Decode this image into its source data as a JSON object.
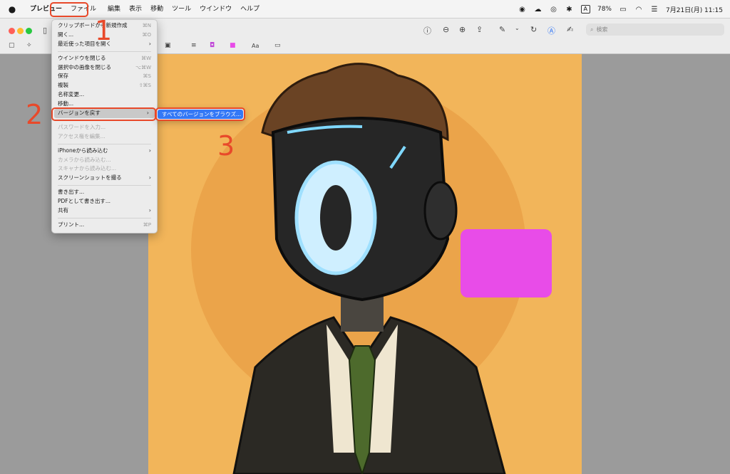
{
  "menubar": {
    "app": "プレビュー",
    "items": [
      "ファイル",
      "編集",
      "表示",
      "移動",
      "ツール",
      "ウインドウ",
      "ヘルプ"
    ],
    "battery": "78%",
    "input_badge": "A",
    "clock": "7月21日(月)  11:15"
  },
  "toolbar": {
    "search_placeholder": "検索",
    "text_style": "Aa"
  },
  "file_menu": {
    "items": [
      {
        "label": "クリップボードから新規作成",
        "shortcut": "⌘N"
      },
      {
        "label": "開く...",
        "shortcut": "⌘O"
      },
      {
        "label": "最近使った項目を開く",
        "arrow": "›"
      },
      {
        "label": "ウインドウを閉じる",
        "shortcut": "⌘W"
      },
      {
        "label": "選択中の画像を閉じる",
        "shortcut": "⌥⌘W"
      },
      {
        "label": "保存",
        "shortcut": "⌘S"
      },
      {
        "label": "複製",
        "shortcut": "⇧⌘S"
      },
      {
        "label": "名称変更..."
      },
      {
        "label": "移動..."
      },
      {
        "label": "バージョンを戻す",
        "arrow": "›"
      },
      {
        "label": "パスワードを入力..."
      },
      {
        "label": "アクセス権を編集..."
      },
      {
        "label": "iPhoneから読み込む",
        "arrow": "›"
      },
      {
        "label": "カメラから読み込む..."
      },
      {
        "label": "スキャナから読み込む..."
      },
      {
        "label": "スクリーンショットを撮る",
        "arrow": "›"
      },
      {
        "label": "書き出す..."
      },
      {
        "label": "PDFとして書き出す..."
      },
      {
        "label": "共有",
        "arrow": "›"
      },
      {
        "label": "プリント...",
        "shortcut": "⌘P"
      }
    ]
  },
  "submenu": {
    "item": "すべてのバージョンをブラウズ..."
  },
  "annotations": {
    "step1": "1",
    "step2": "2",
    "step3": "3"
  },
  "colors": {
    "annotation": "#e8492a",
    "highlight": "#3478f6",
    "art_bg": "#f2b55a",
    "pink_shape": "#e84ce8"
  }
}
